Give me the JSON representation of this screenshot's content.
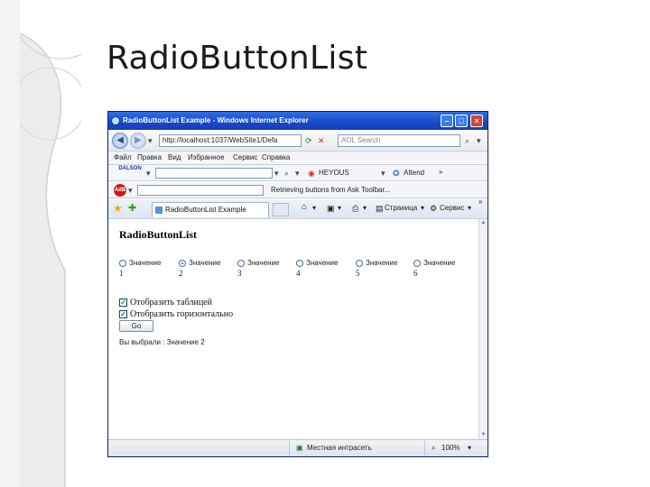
{
  "slide": {
    "title": "RadioButtonList"
  },
  "browser": {
    "window_title": "RadioButtonList Example - Windows Internet Explorer",
    "address": "http://localhost:1037/WebSite1/Defa",
    "search_placeholder": "AOL Search",
    "menu": [
      "Файл",
      "Правка",
      "Вид",
      "Избранное",
      "Сервис",
      "Справка"
    ],
    "toolbar1": {
      "logo": "DALSON",
      "field2": "HEYOUS",
      "extra": "Attend",
      "more": "»"
    },
    "toolbar2": {
      "logo": "AdB",
      "message": "Retrieving buttons from Ask Toolbar..."
    },
    "tab_title": "RadioButtonList Example",
    "commands": {
      "page": "Страница",
      "tools": "Сервис"
    },
    "status": {
      "zone": "Местная интрасеть",
      "zoom": "100%"
    }
  },
  "page": {
    "heading": "RadioButtonList",
    "radios": [
      {
        "label": "Значение",
        "number": "1",
        "selected": false
      },
      {
        "label": "Значение",
        "number": "2",
        "selected": true
      },
      {
        "label": "Значение",
        "number": "3",
        "selected": false
      },
      {
        "label": "Значение",
        "number": "4",
        "selected": false
      },
      {
        "label": "Значение",
        "number": "5",
        "selected": false
      },
      {
        "label": "Значение",
        "number": "6",
        "selected": false
      }
    ],
    "checkboxes": [
      {
        "label": "Отобразить таблицей",
        "checked": true
      },
      {
        "label": "Отобразить горизонтально",
        "checked": true
      }
    ],
    "go_button": "Go",
    "result": "Вы выбрали : Значение 2"
  }
}
